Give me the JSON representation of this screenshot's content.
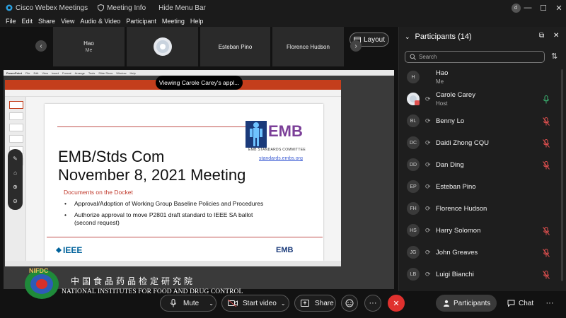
{
  "window": {
    "app_title": "Cisco Webex Meetings",
    "meeting_info": "Meeting Info",
    "hide_menu": "Hide Menu Bar",
    "controls": {
      "minimize": "—",
      "maximize": "☐",
      "close": "✕",
      "avatar_letter": "d"
    }
  },
  "menu": [
    "File",
    "Edit",
    "Share",
    "View",
    "Audio & Video",
    "Participant",
    "Meeting",
    "Help"
  ],
  "video_strip": {
    "tiles": [
      {
        "name": "Hao",
        "sub": "Me"
      },
      {
        "name": "",
        "sub": ""
      },
      {
        "name": "Esteban Pino",
        "sub": ""
      },
      {
        "name": "Florence Hudson",
        "sub": ""
      }
    ],
    "layout_label": "Layout"
  },
  "shared": {
    "viewing_badge": "Viewing Carole Carey's appl...",
    "app_menu": [
      "PowerPoint",
      "File",
      "Edit",
      "View",
      "Insert",
      "Format",
      "Arrange",
      "Tools",
      "Slide Show",
      "Window",
      "Help"
    ],
    "slide": {
      "title_line1": "EMB/Stds Com",
      "title_line2": "November 8, 2021 Meeting",
      "docket_heading": "Documents on the Docket",
      "bullets": [
        "Approval/Adoption of Working Group Baseline Policies and Procedures",
        "Authorize approval to move P2801 draft standard to IEEE SA ballot",
        "(second request)"
      ],
      "logo_text": "EMB",
      "logo_caption": "EMB STANDARDS COMMITTEE",
      "logo_link": "standards.embs.org",
      "footer_left": "IEEE",
      "footer_right": "EMB"
    }
  },
  "watermark": {
    "chinese": "中国食品药品检定研究院",
    "english": "NATIONAL INSTITUTES FOR FOOD AND DRUG CONTROL",
    "logo_text": "NIFDC"
  },
  "controls": {
    "mute": "Mute",
    "start_video": "Start video",
    "share": "Share",
    "participants": "Participants",
    "chat": "Chat"
  },
  "panel": {
    "title": "Participants (14)",
    "search_placeholder": "Search",
    "participants": [
      {
        "initials": "H",
        "name": "Hao",
        "sub": "Me",
        "sync": false,
        "mic": "none"
      },
      {
        "initials": "",
        "name": "Carole Carey",
        "sub": "Host",
        "sync": true,
        "mic": "active"
      },
      {
        "initials": "BL",
        "name": "Benny Lo",
        "sub": "",
        "sync": true,
        "mic": "muted"
      },
      {
        "initials": "DC",
        "name": "Daidi Zhong CQU",
        "sub": "",
        "sync": true,
        "mic": "muted"
      },
      {
        "initials": "DD",
        "name": "Dan Ding",
        "sub": "",
        "sync": true,
        "mic": "muted"
      },
      {
        "initials": "EP",
        "name": "Esteban Pino",
        "sub": "",
        "sync": true,
        "mic": "none"
      },
      {
        "initials": "FH",
        "name": "Florence Hudson",
        "sub": "",
        "sync": true,
        "mic": "none"
      },
      {
        "initials": "HS",
        "name": "Harry Solomon",
        "sub": "",
        "sync": true,
        "mic": "muted"
      },
      {
        "initials": "JG",
        "name": "John Greaves",
        "sub": "",
        "sync": true,
        "mic": "muted"
      },
      {
        "initials": "LB",
        "name": "Luigi Bianchi",
        "sub": "",
        "sync": true,
        "mic": "muted"
      }
    ]
  },
  "colors": {
    "accent_green": "#3cb371",
    "muted_red": "#e0504f",
    "end_red": "#e0312e"
  }
}
